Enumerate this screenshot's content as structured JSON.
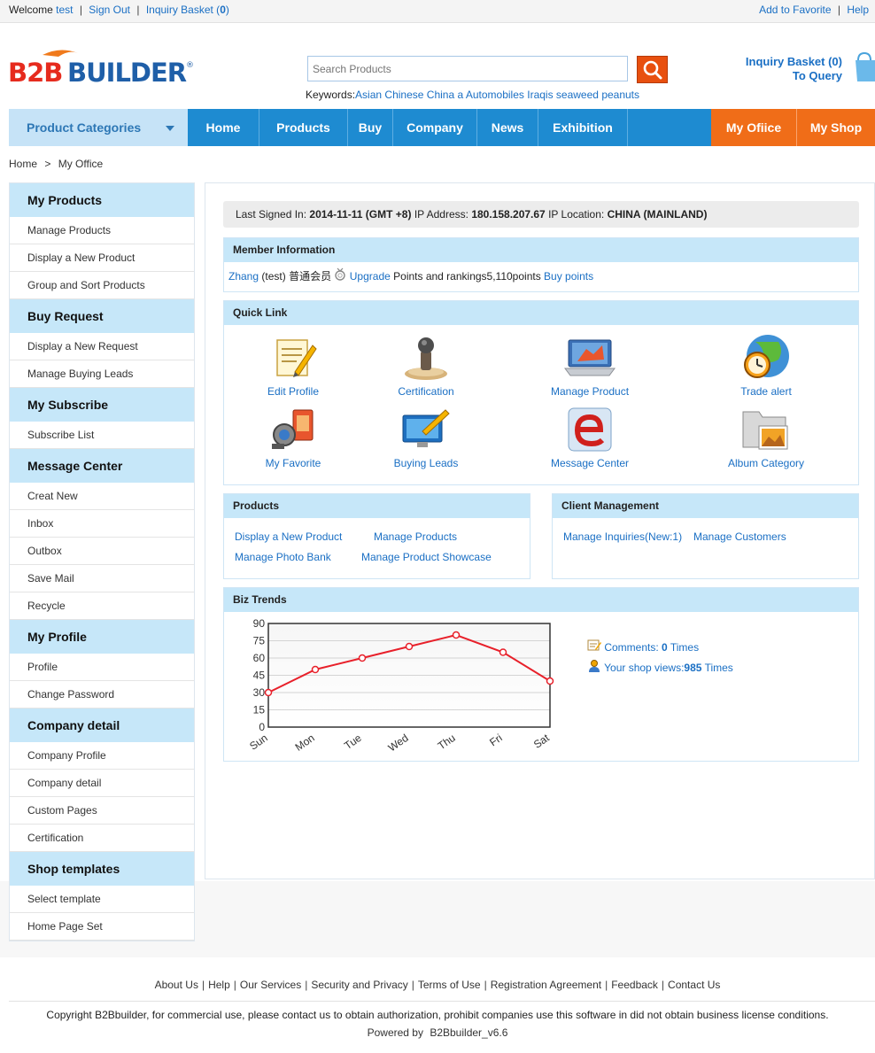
{
  "topbar": {
    "welcome": "Welcome",
    "user": "test",
    "sign_out": "Sign Out",
    "basket_label": "Inquiry Basket (",
    "basket_count": "0",
    "basket_close": ")",
    "add_favorite": "Add to Favorite",
    "help": "Help"
  },
  "header": {
    "logo_text": "B2BBUILDER",
    "search_placeholder": "Search Products",
    "keywords_label": "Keywords:",
    "keywords": [
      "Asian",
      "Chinese",
      "China",
      "a",
      "Automobiles",
      "Iraqis",
      "seaweed",
      "peanuts"
    ],
    "basket_link": "Inquiry Basket (0)",
    "to_query": "To Query"
  },
  "nav": {
    "categories": "Product Categories",
    "items": [
      "Home",
      "Products",
      "Buy",
      "Company",
      "News",
      "Exhibition"
    ],
    "right_items": [
      "My Ofiice",
      "My Shop"
    ]
  },
  "breadcrumb": {
    "home": "Home",
    "sep": ">",
    "current": "My Office"
  },
  "sidebar": [
    {
      "title": "My Products",
      "items": [
        "Manage Products",
        "Display a New Product",
        "Group and Sort Products"
      ]
    },
    {
      "title": "Buy Request",
      "items": [
        "Display a New Request",
        "Manage Buying Leads"
      ]
    },
    {
      "title": "My Subscribe",
      "items": [
        "Subscribe List"
      ]
    },
    {
      "title": "Message Center",
      "items": [
        "Creat New",
        "Inbox",
        "Outbox",
        "Save Mail",
        "Recycle"
      ]
    },
    {
      "title": "My Profile",
      "items": [
        "Profile",
        "Change Password"
      ]
    },
    {
      "title": "Company detail",
      "items": [
        "Company Profile",
        "Company detail",
        "Custom Pages",
        "Certification"
      ]
    },
    {
      "title": "Shop templates",
      "items": [
        "Select template",
        "Home Page Set"
      ]
    }
  ],
  "signed": {
    "label": "Last Signed In:",
    "date": "2014-11-11 (GMT +8)",
    "ip_label": "IP Address:",
    "ip": "180.158.207.67",
    "loc_label": "IP Location:",
    "loc": "CHINA (MAINLAND)"
  },
  "member": {
    "title": "Member Information",
    "name": "Zhang",
    "user": "(test)",
    "level": "普通会员",
    "upgrade": "Upgrade",
    "points_text": "Points and rankings5,110points",
    "buy_points": "Buy points"
  },
  "quicklink": {
    "title": "Quick Link",
    "items": [
      "Edit Profile",
      "Certification",
      "Manage Product",
      "Trade alert",
      "My Favorite",
      "Buying Leads",
      "Message Center",
      "Album Category"
    ]
  },
  "products_box": {
    "title": "Products",
    "links": [
      "Display a New Product",
      "Manage Products",
      "Manage Photo Bank",
      "Manage Product Showcase"
    ]
  },
  "client_box": {
    "title": "Client Management",
    "links": [
      "Manage Inquiries(New:1)",
      "Manage Customers"
    ]
  },
  "biz": {
    "title": "Biz Trends",
    "comments_label": "Comments:",
    "comments_count": "0",
    "comments_unit": "Times",
    "views_label": "Your shop views:",
    "views_count": "985",
    "views_unit": "Times"
  },
  "chart_data": {
    "type": "line",
    "categories": [
      "Sun",
      "Mon",
      "Tue",
      "Wed",
      "Thu",
      "Fri",
      "Sat"
    ],
    "series": [
      {
        "values": [
          30,
          50,
          60,
          70,
          80,
          65,
          40
        ]
      }
    ],
    "yticks": [
      0,
      15,
      30,
      45,
      60,
      75,
      90
    ],
    "ylim": [
      0,
      90
    ],
    "line_color": "#e8202a"
  },
  "footer": {
    "links": [
      "About Us",
      "Help",
      "Our Services",
      "Security and Privacy",
      "Terms of Use",
      "Registration Agreement",
      "Feedback",
      "Contact Us"
    ],
    "copyright": "Copyright B2Bbuilder, for commercial use, please contact us to obtain authorization, prohibit companies use this software in did not obtain business license conditions.",
    "powered_label": "Powered by",
    "powered": "B2Bbuilder_v6.6"
  }
}
